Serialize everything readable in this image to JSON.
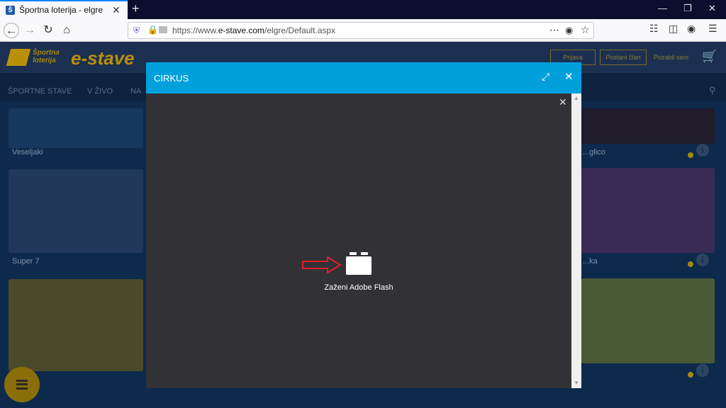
{
  "browser": {
    "tab_title": "Športna loterija - elgre",
    "tab_close": "✕",
    "new_tab": "+",
    "url_prefix": "https://www.",
    "url_domain": "e-stave.com",
    "url_path": "/elgre/Default.aspx",
    "url_full": "https://www.e-stave.com/elgre/Default.aspx",
    "icons": [
      "back-icon",
      "forward-icon",
      "reload-icon",
      "home-icon",
      "shield-icon",
      "lock-icon",
      "more-icon",
      "pocket-icon",
      "star-icon",
      "library-icon",
      "sidebar-icon",
      "account-icon",
      "menu-icon"
    ]
  },
  "site": {
    "logo_sub": "Športna loterija",
    "logo_big": "e-stave",
    "header_btn_1": "Prijava",
    "header_btn_2": "Postani član",
    "header_link": "Pozabil sem",
    "menu": [
      "ŠPORTNE STAVE",
      "V ŽIVO",
      "NA"
    ],
    "tiles": [
      "Veseljaki",
      "Super 7",
      "...glico",
      "...ka"
    ]
  },
  "modal": {
    "title": "CIRKUS",
    "flash_label": "Zaženi Adobe Flash",
    "close_symbol": "✕",
    "inner_close_symbol": "✕"
  },
  "colors": {
    "modal_header": "#00a0dc",
    "modal_body": "#323136",
    "annotation_arrow": "#e0202a"
  }
}
